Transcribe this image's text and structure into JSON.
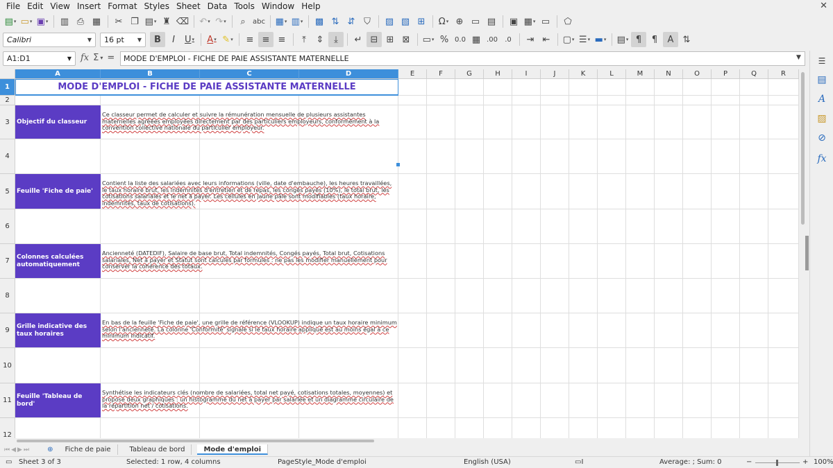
{
  "menu": [
    "File",
    "Edit",
    "View",
    "Insert",
    "Format",
    "Styles",
    "Sheet",
    "Data",
    "Tools",
    "Window",
    "Help"
  ],
  "toolbar": {
    "font_name": "Calibri",
    "font_size": "16 pt"
  },
  "formula_bar": {
    "cell_ref": "A1:D1",
    "content": "MODE D'EMPLOI - FICHE DE PAIE ASSISTANTE MATERNELLE"
  },
  "columns": [
    "A",
    "B",
    "C",
    "D",
    "E",
    "F",
    "G",
    "H",
    "I",
    "J",
    "K",
    "L",
    "M",
    "N",
    "O",
    "P",
    "Q",
    "R"
  ],
  "rows": [
    "1",
    "2",
    "3",
    "4",
    "5",
    "6",
    "7",
    "8",
    "9",
    "10",
    "11",
    "12"
  ],
  "sheet": {
    "title": "MODE D'EMPLOI - FICHE DE PAIE ASSISTANTE MATERNELLE",
    "sections": [
      {
        "label": "Objectif du classeur",
        "text": "Ce classeur permet de calculer et suivre la rémunération mensuelle de plusieurs assistantes maternelles agréées employées directement par des particuliers employeurs, conformément à la convention collective nationale du particulier employeur."
      },
      {
        "label": "Feuille 'Fiche de paie'",
        "text": "Contient la liste des salariées avec leurs informations (ville, date d'embauche), les heures travaillées, le taux horaire brut, les indemnités d'entretien et de repas, les congés payés (10%), le total brut, les cotisations salariales et le net à payer. Les cellules en jaune pâle sont modifiables (taux horaire, indemnités, taux de cotisations)."
      },
      {
        "label": "Colonnes calculées automatiquement",
        "text": "Ancienneté (DATEDIF), Salaire de base brut, Total indemnités, Congés payés, Total brut, Cotisations salariales, Net à payer et Statut sont calculés par formules : ne pas les modifier manuellement pour conserver la cohérence des totaux."
      },
      {
        "label": "Grille indicative des taux horaires",
        "text": "En bas de la feuille 'Fiche de paie', une grille de référence (VLOOKUP) indique un taux horaire minimum selon l'ancienneté. La colonne 'Conformité' signale si le taux horaire appliqué est au moins égal à ce minimum indicatif."
      },
      {
        "label": "Feuille 'Tableau de bord'",
        "text": "Synthétise les indicateurs clés (nombre de salariées, total net payé, cotisations totales, moyennes) et propose deux graphiques : un histogramme du net à payer par salariée et un diagramme circulaire de la répartition net / cotisations."
      }
    ]
  },
  "tabs": [
    "Fiche de paie",
    "Tableau de bord",
    "Mode d'emploi"
  ],
  "status": {
    "sheet": "Sheet 3 of 3",
    "selection": "Selected: 1 row, 4 columns",
    "page_style": "PageStyle_Mode d'emploi",
    "language": "English (USA)",
    "summary": "Average: ; Sum: 0",
    "zoom": "100%"
  },
  "colors": {
    "accent_purple": "#5b3cc4",
    "selection_blue": "#3d8fdb"
  }
}
